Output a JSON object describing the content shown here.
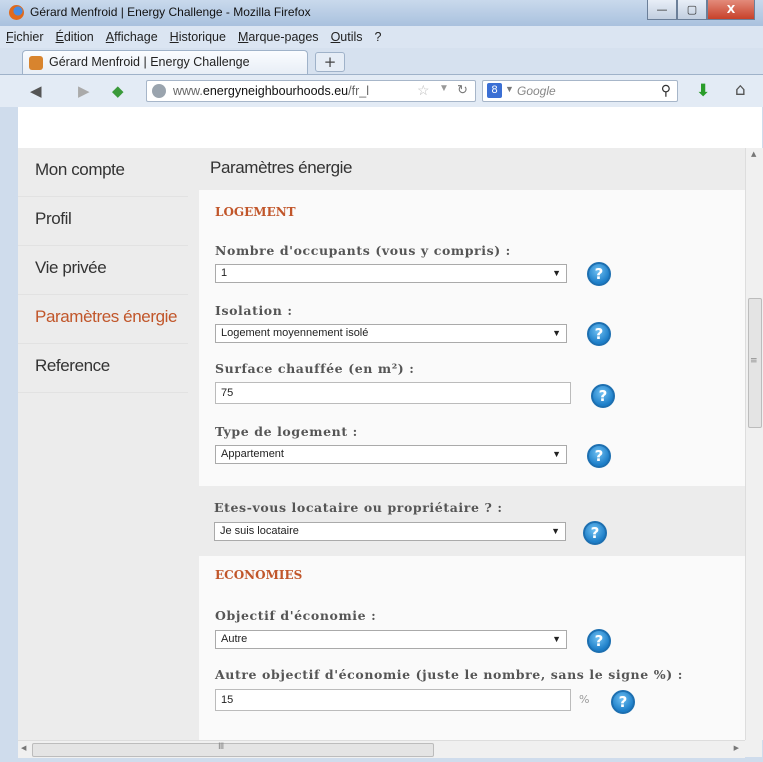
{
  "window": {
    "title": "Gérard Menfroid | Energy Challenge - Mozilla Firefox",
    "minimize": "—",
    "maximize": "▢",
    "close": "X"
  },
  "menu": [
    "Fichier",
    "Édition",
    "Affichage",
    "Historique",
    "Marque-pages",
    "Outils",
    "?"
  ],
  "tab": {
    "label": "Gérard Menfroid | Energy Challenge",
    "new_tab": "+"
  },
  "nav": {
    "url_prefix": "www.",
    "url_domain": "energyneighbourhoods.eu",
    "url_path": "/fr_l",
    "search_engine": "8",
    "search_placeholder": "Google"
  },
  "sidebar": {
    "items": [
      {
        "label": "Mon compte",
        "active": false
      },
      {
        "label": "Profil",
        "active": false
      },
      {
        "label": "Vie privée",
        "active": false
      },
      {
        "label": "Paramètres énergie",
        "active": true
      },
      {
        "label": "Reference",
        "active": false
      }
    ]
  },
  "main": {
    "title": "Paramètres énergie",
    "logement": {
      "section": "LOGEMENT",
      "occupants_label": "Nombre d'occupants (vous y compris) :",
      "occupants_value": "1",
      "isolation_label": "Isolation :",
      "isolation_value": "Logement moyennement isolé",
      "surface_label": "Surface chauffée (en m²) :",
      "surface_value": "75",
      "type_label": "Type de logement :",
      "type_value": "Appartement"
    },
    "statut": {
      "label": "Etes-vous locataire ou propriétaire ? :",
      "value": "Je suis locataire"
    },
    "economies": {
      "section": "ECONOMIES",
      "objectif_label": "Objectif d'économie :",
      "objectif_value": "Autre",
      "autre_label": "Autre objectif d'économie (juste le nombre, sans le signe %) :",
      "autre_value": "15",
      "percent": "%"
    },
    "help_glyph": "?"
  },
  "colors": {
    "accent": "#c1562a",
    "help_blue": "#1d7ec8"
  }
}
